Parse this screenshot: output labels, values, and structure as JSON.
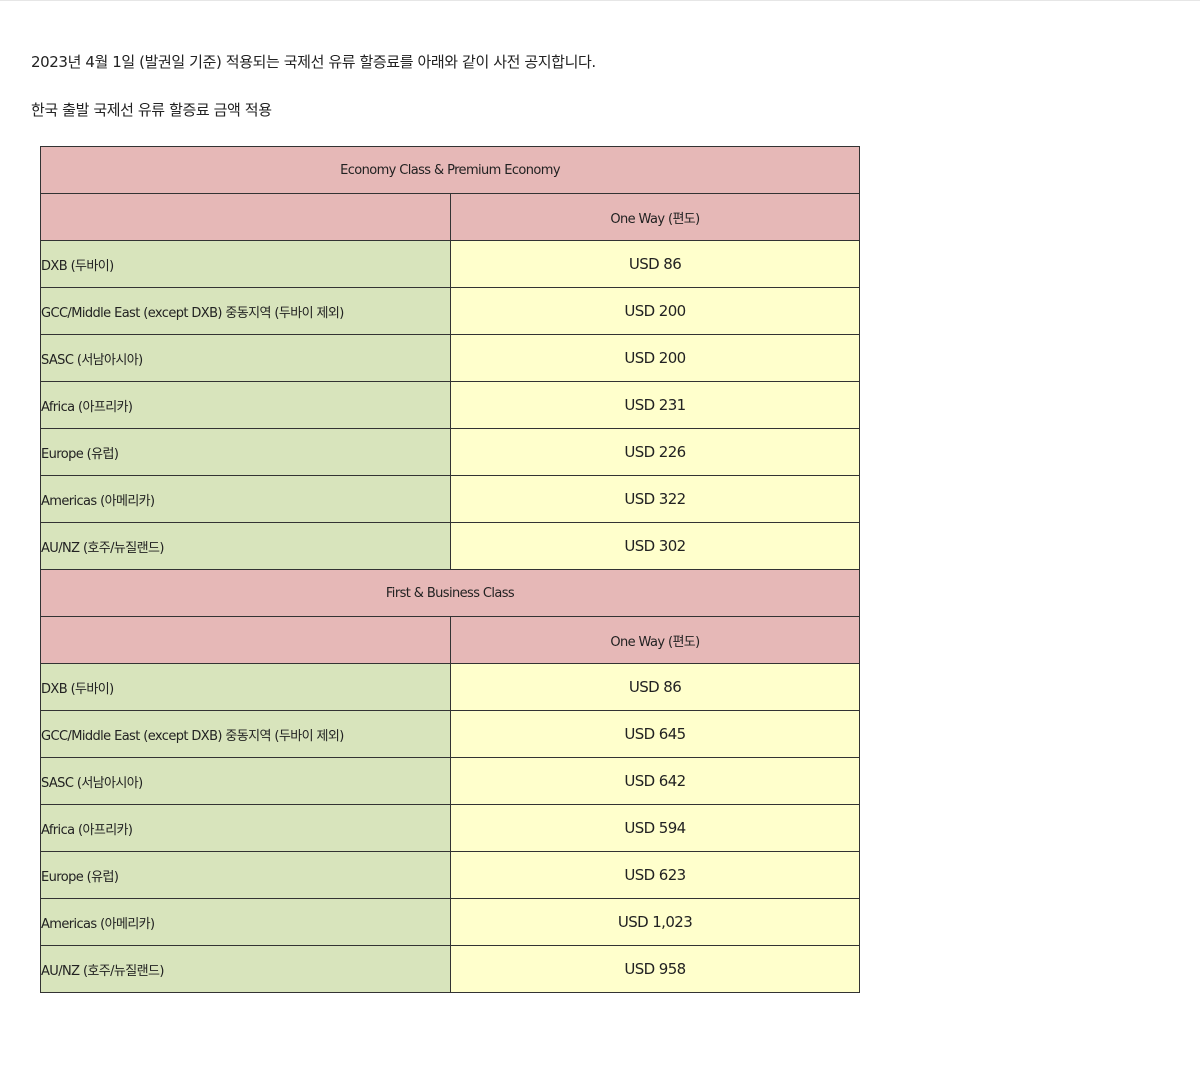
{
  "notice_text": "2023년 4월 1일 (발권일 기준) 적용되는 국제선 유류 할증료를 아래와 같이 사전 공지합니다.",
  "subheading": "한국 출발 국제선 유류 할증료 금액 적용",
  "sections": [
    {
      "title": "Economy Class & Premium Economy",
      "column_header": "One Way (편도)",
      "rows": [
        {
          "region": "DXB (두바이)",
          "price": "USD 86"
        },
        {
          "region": "GCC/Middle East (except DXB) 중동지역 (두바이 제외)",
          "price": "USD 200"
        },
        {
          "region": "SASC (서남아시아)",
          "price": "USD 200"
        },
        {
          "region": "Africa (아프리카)",
          "price": "USD 231"
        },
        {
          "region": "Europe (유럽)",
          "price": "USD 226"
        },
        {
          "region": "Americas (아메리카)",
          "price": "USD 322"
        },
        {
          "region": "AU/NZ (호주/뉴질랜드)",
          "price": "USD 302"
        }
      ]
    },
    {
      "title": "First & Business Class",
      "column_header": "One Way (편도)",
      "rows": [
        {
          "region": "DXB (두바이)",
          "price": "USD 86"
        },
        {
          "region": "GCC/Middle East (except DXB) 중동지역 (두바이 제외)",
          "price": "USD 645"
        },
        {
          "region": "SASC (서남아시아)",
          "price": "USD 642"
        },
        {
          "region": "Africa (아프리카)",
          "price": "USD 594"
        },
        {
          "region": "Europe (유럽)",
          "price": "USD 623"
        },
        {
          "region": "Americas (아메리카)",
          "price": "USD 1,023"
        },
        {
          "region": "AU/NZ (호주/뉴질랜드)",
          "price": "USD 958"
        }
      ]
    }
  ],
  "colors": {
    "header_bg": "#e6b8b7",
    "region_bg": "#d8e4bc",
    "price_bg": "#ffffcc",
    "border": "#333333"
  }
}
